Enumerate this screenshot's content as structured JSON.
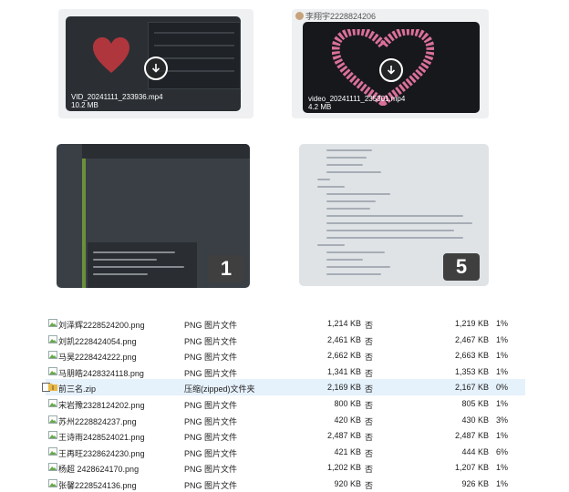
{
  "thumbnails": {
    "video1": {
      "filename": "VID_20241111_233936.mp4",
      "size": "10.2 MB",
      "icon": "download-icon"
    },
    "video2": {
      "uploader": "李翔宇2228824206",
      "filename": "video_20241111_235301.mp4",
      "size": "4.2 MB",
      "icon": "download-icon"
    },
    "image3": {
      "more_count": "1"
    },
    "image4": {
      "more_count": "5"
    }
  },
  "files": [
    {
      "name": "刘泽辉2228524200.png",
      "type": "PNG 图片文件",
      "size": "1,214 KB",
      "password": "否",
      "original": "1,219 KB",
      "ratio": "1%",
      "icon": "png-file-icon"
    },
    {
      "name": "刘凯2228424054.png",
      "type": "PNG 图片文件",
      "size": "2,461 KB",
      "password": "否",
      "original": "2,467 KB",
      "ratio": "1%",
      "icon": "png-file-icon"
    },
    {
      "name": "马昊2228424222.png",
      "type": "PNG 图片文件",
      "size": "2,662 KB",
      "password": "否",
      "original": "2,663 KB",
      "ratio": "1%",
      "icon": "png-file-icon"
    },
    {
      "name": "马朋皓2428324118.png",
      "type": "PNG 图片文件",
      "size": "1,341 KB",
      "password": "否",
      "original": "1,353 KB",
      "ratio": "1%",
      "icon": "png-file-icon"
    },
    {
      "name": "前三名.zip",
      "type": "压缩(zipped)文件夹",
      "size": "2,169 KB",
      "password": "否",
      "original": "2,167 KB",
      "ratio": "0%",
      "icon": "zip-folder-icon",
      "selected": true
    },
    {
      "name": "宋岩豫2328124202.png",
      "type": "PNG 图片文件",
      "size": "800 KB",
      "password": "否",
      "original": "805 KB",
      "ratio": "1%",
      "icon": "png-file-icon"
    },
    {
      "name": "苏州2228824237.png",
      "type": "PNG 图片文件",
      "size": "420 KB",
      "password": "否",
      "original": "430 KB",
      "ratio": "3%",
      "icon": "png-file-icon"
    },
    {
      "name": "王诗雨2428524021.png",
      "type": "PNG 图片文件",
      "size": "2,487 KB",
      "password": "否",
      "original": "2,487 KB",
      "ratio": "1%",
      "icon": "png-file-icon"
    },
    {
      "name": "王再旺2328624230.png",
      "type": "PNG 图片文件",
      "size": "421 KB",
      "password": "否",
      "original": "444 KB",
      "ratio": "6%",
      "icon": "png-file-icon"
    },
    {
      "name": "杨超 2428624170.png",
      "type": "PNG 图片文件",
      "size": "1,202 KB",
      "password": "否",
      "original": "1,207 KB",
      "ratio": "1%",
      "icon": "png-file-icon"
    },
    {
      "name": "张馨2228524136.png",
      "type": "PNG 图片文件",
      "size": "920 KB",
      "password": "否",
      "original": "926 KB",
      "ratio": "1%",
      "icon": "png-file-icon"
    }
  ],
  "colors": {
    "selected_row": "#e5f1fb",
    "heart_red": "#c8373f",
    "heart_pink": "#f07aa8",
    "zip_folder": "#e9b949",
    "png_icon": "#6aa84f"
  }
}
